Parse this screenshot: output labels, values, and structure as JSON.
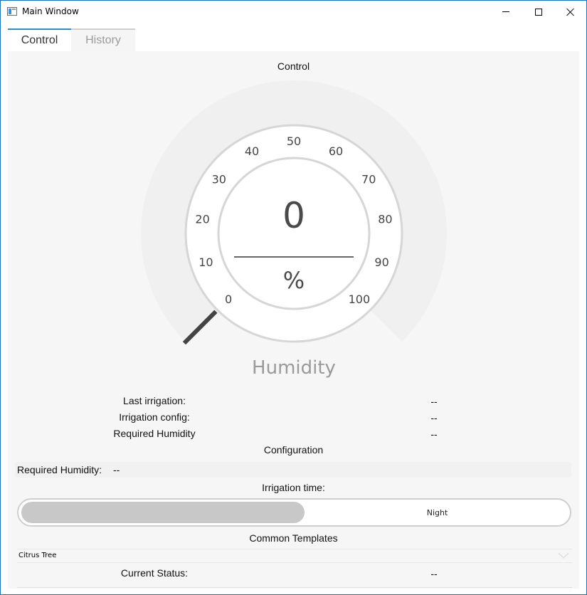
{
  "window": {
    "title": "Main Window"
  },
  "tabs": [
    {
      "label": "Control",
      "active": true
    },
    {
      "label": "History",
      "active": false
    }
  ],
  "control": {
    "heading": "Control",
    "gauge": {
      "value": "0",
      "unit": "%",
      "title": "Humidity",
      "min": 0,
      "max": 100,
      "current": 0,
      "ticks": [
        "0",
        "10",
        "20",
        "30",
        "40",
        "50",
        "60",
        "70",
        "80",
        "90",
        "100"
      ]
    },
    "info": [
      {
        "label": "Last irrigation:",
        "value": "--"
      },
      {
        "label": "Irrigation config:",
        "value": "--"
      },
      {
        "label": "Required Humidity",
        "value": "--"
      }
    ],
    "configuration": {
      "heading": "Configuration",
      "required_humidity_label": "Required Humidity:",
      "required_humidity_value": "--",
      "irrigation_time_label": "Irrigation time:",
      "irrigation_toggle": {
        "off_label": "",
        "on_label": "Night",
        "selected": "left"
      }
    },
    "templates": {
      "heading": "Common Templates",
      "selected": "Citrus Tree"
    },
    "status": {
      "label": "Current Status:",
      "value": "--"
    }
  },
  "colors": {
    "accent": "#2a8cd8",
    "gauge_text": "#4a4a4a",
    "gauge_title": "#9a9a9a",
    "track": "#f0f0f0",
    "needle": "#444444"
  }
}
